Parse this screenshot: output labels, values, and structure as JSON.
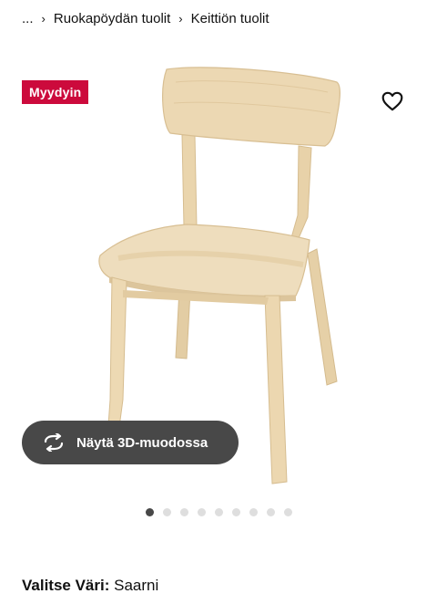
{
  "breadcrumb": {
    "ellipsis": "...",
    "items": [
      "Ruokapöydän tuolit",
      "Keittiön tuolit"
    ]
  },
  "product": {
    "badge": "Myydyin",
    "favorite_icon": "heart-outline-icon",
    "view_3d_label": "Näytä 3D-muodossa",
    "view_3d_icon": "rotate-3d-icon",
    "image_count": 9,
    "active_image_index": 0
  },
  "color": {
    "label": "Valitse Väri:",
    "value": "Saarni"
  },
  "colors": {
    "badge_bg": "#cc0a3c",
    "button_bg": "#484848",
    "dot_active": "#484848",
    "dot_inactive": "#dedede",
    "wood": "#ecd9b6"
  }
}
